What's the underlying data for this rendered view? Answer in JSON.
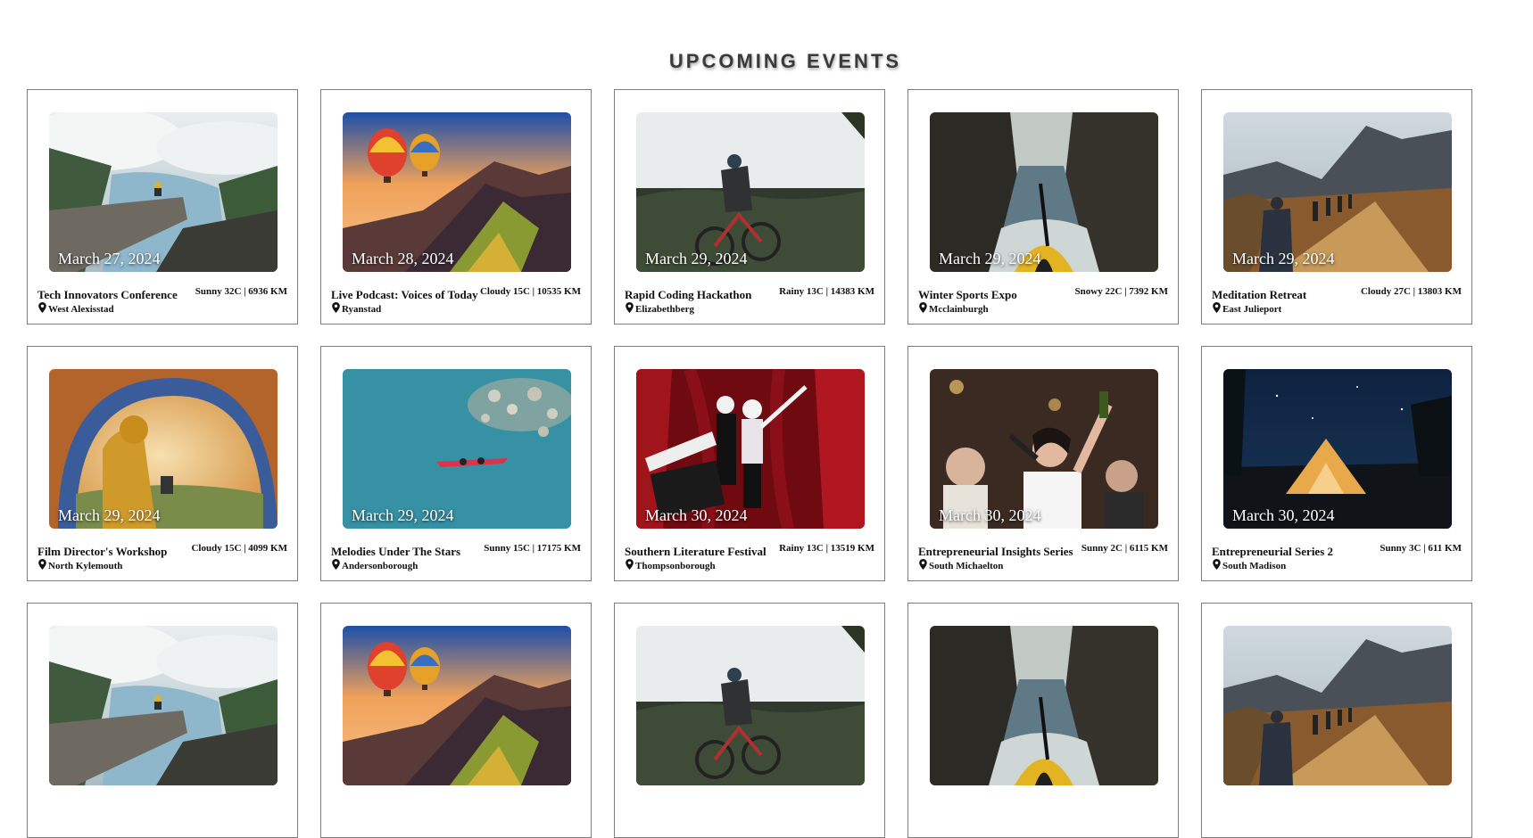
{
  "page": {
    "title": "UPCOMING EVENTS"
  },
  "events": [
    {
      "date": "March 27, 2024",
      "title": "Tech Innovators Conference",
      "weather": "Sunny 32C | 6936 KM",
      "location": "West Alexisstad",
      "image": "fjord-cliff"
    },
    {
      "date": "March 28, 2024",
      "title": "Live Podcast: Voices of Today",
      "weather": "Cloudy 15C | 10535 KM",
      "location": "Ryanstad",
      "image": "hot-air-balloons"
    },
    {
      "date": "March 29, 2024",
      "title": "Rapid Coding Hackathon",
      "weather": "Rainy 13C | 14383 KM",
      "location": "Elizabethberg",
      "image": "mountain-biker"
    },
    {
      "date": "March 29, 2024",
      "title": "Winter Sports Expo",
      "weather": "Snowy 22C | 7392 KM",
      "location": "Mcclainburgh",
      "image": "kayak-canyon"
    },
    {
      "date": "March 29, 2024",
      "title": "Meditation Retreat",
      "weather": "Cloudy 27C | 13803 KM",
      "location": "East Julieport",
      "image": "hikers-mountain"
    },
    {
      "date": "March 29, 2024",
      "title": "Film Director's Workshop",
      "weather": "Cloudy 15C | 4099 KM",
      "location": "North Kylemouth",
      "image": "tent-sunset"
    },
    {
      "date": "March 29, 2024",
      "title": "Melodies Under The Stars",
      "weather": "Sunny 15C | 17175 KM",
      "location": "Andersonborough",
      "image": "kayak-aerial"
    },
    {
      "date": "March 30, 2024",
      "title": "Southern Literature Festival",
      "weather": "Rainy 13C | 13519 KM",
      "location": "Thompsonborough",
      "image": "theater-mimes"
    },
    {
      "date": "March 30, 2024",
      "title": "Entrepreneurial Insights Series",
      "weather": "Sunny 2C | 6115 KM",
      "location": "South Michaelton",
      "image": "singer-party"
    },
    {
      "date": "March 30, 2024",
      "title": "Entrepreneurial Series 2",
      "weather": "Sunny 3C | 611 KM",
      "location": "South Madison",
      "image": "tent-night"
    },
    {
      "date": "",
      "title": "",
      "weather": "",
      "location": "",
      "image": "fjord-cliff"
    },
    {
      "date": "",
      "title": "",
      "weather": "",
      "location": "",
      "image": "hot-air-balloons"
    },
    {
      "date": "",
      "title": "",
      "weather": "",
      "location": "",
      "image": "mountain-biker"
    },
    {
      "date": "",
      "title": "",
      "weather": "",
      "location": "",
      "image": "kayak-canyon"
    },
    {
      "date": "",
      "title": "",
      "weather": "",
      "location": "",
      "image": "hikers-mountain"
    }
  ],
  "icons": {
    "location": "map-pin-icon"
  }
}
